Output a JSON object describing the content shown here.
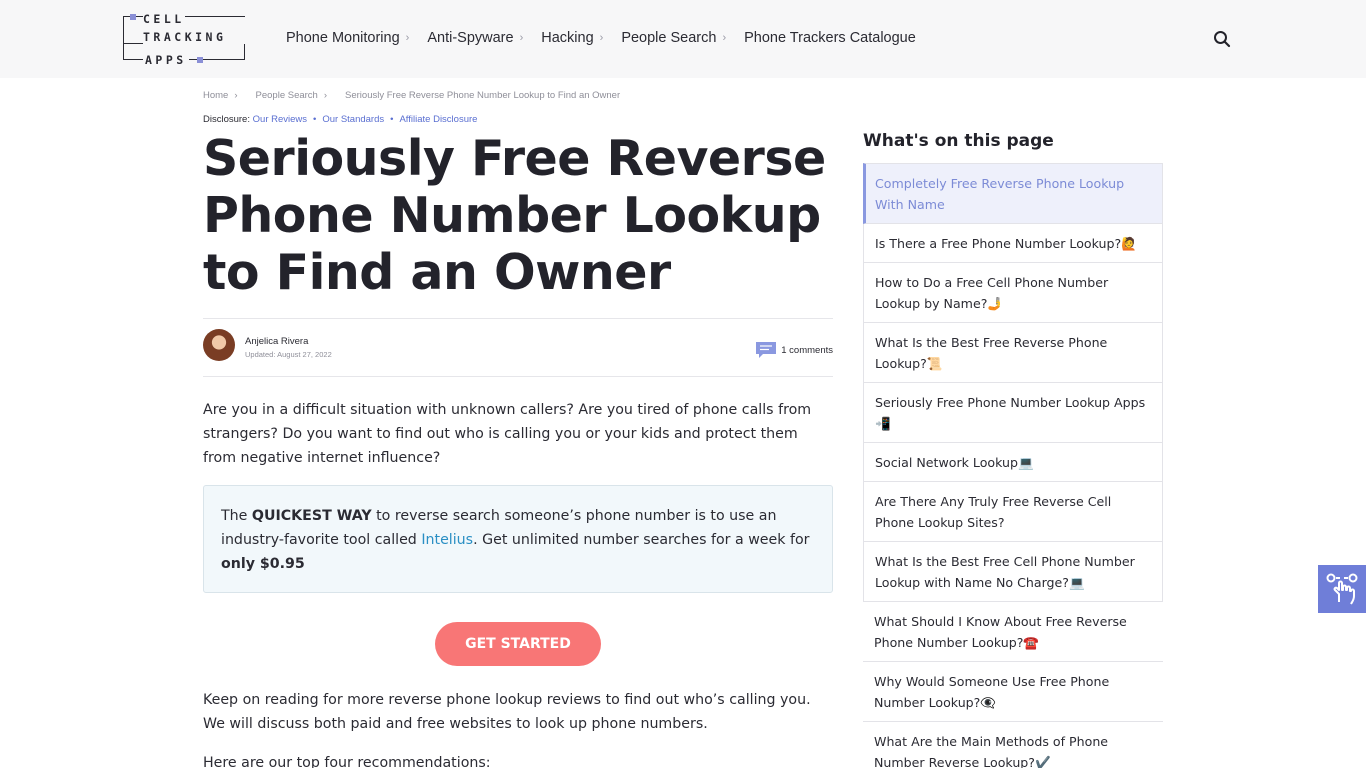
{
  "header": {
    "logo": {
      "line1": "CELL",
      "line2": "TRACKING",
      "line3": "APPS"
    },
    "nav": [
      {
        "label": "Phone Monitoring",
        "has_chevron": true
      },
      {
        "label": "Anti-Spyware",
        "has_chevron": true
      },
      {
        "label": "Hacking",
        "has_chevron": true
      },
      {
        "label": "People Search",
        "has_chevron": true
      },
      {
        "label": "Phone Trackers Catalogue",
        "has_chevron": false
      }
    ],
    "search_icon": "search-icon"
  },
  "breadcrumb": {
    "items": [
      "Home",
      "People Search",
      "Seriously Free Reverse Phone Number Lookup to Find an Owner"
    ],
    "separator": "›"
  },
  "disclosure": {
    "label": "Disclosure:",
    "links": [
      "Our Reviews",
      "Our Standards",
      "Affiliate Disclosure"
    ],
    "dot": "•"
  },
  "article": {
    "title": "Seriously Free Reverse Phone Number Lookup to Find an Owner",
    "author": "Anjelica Rivera",
    "updated": "Updated: August 27, 2022",
    "comments": "1 comments",
    "intro": "Are you in a difficult situation with unknown callers? Are you tired of phone calls from strangers? Do you want to find out who is calling you or your kids and protect them from negative internet influence?",
    "callout": {
      "prefix": "The ",
      "bold1": "QUICKEST WAY",
      "middle": " to reverse search someone’s phone number is to use an industry-favorite tool called ",
      "link": "Intelius",
      "after": ". Get unlimited number searches for a week for ",
      "bold2": "only $0.95"
    },
    "cta": "GET STARTED",
    "p2": "Keep on reading for more reverse phone lookup reviews to find out who’s calling you. We will discuss both paid and free websites to look up phone numbers.",
    "p3": "Here are our top four recommendations:"
  },
  "toc": {
    "title": "What's on this page",
    "items": [
      "Completely Free Reverse Phone Lookup With Name",
      "Is There a Free Phone Number Lookup?🙋",
      "How to Do a Free Cell Phone Number Lookup by Name?🤳",
      "What Is the Best Free Reverse Phone Lookup?📜",
      "Seriously Free Phone Number Lookup Apps 📲",
      "Social Network Lookup💻",
      "Are There Any Truly Free Reverse Cell Phone Lookup Sites?",
      "What Is the Best Free Cell Phone Number Lookup with Name No Charge?💻",
      "What Should I Know About Free Reverse Phone Number Lookup?☎️",
      "Why Would Someone Use Free Phone Number Lookup?👁️‍🗨️",
      "What Are the Main Methods of Phone Number Reverse Lookup?✔️"
    ]
  },
  "accessibility_icon": "hand-tap-icon",
  "colors": {
    "accent": "#6f7ed8",
    "cta": "#f87676",
    "link": "#2a8fc4"
  }
}
